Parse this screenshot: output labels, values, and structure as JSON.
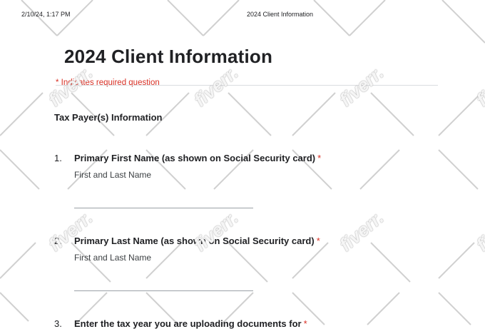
{
  "print_header": {
    "datetime": "2/10/24, 1:17 PM",
    "doc_title": "2024 Client Information"
  },
  "form": {
    "title": "2024 Client Information",
    "required_note": "* Indicates required question",
    "section_title": "Tax Payer(s) Information",
    "questions": [
      {
        "number": "1.",
        "label": "Primary First Name (as shown on Social Security card)",
        "required_marker": "*",
        "help": "First and Last Name"
      },
      {
        "number": "2.",
        "label": "Primary Last Name (as shown on Social Security card)",
        "required_marker": "*",
        "help": "First and Last Name"
      },
      {
        "number": "3.",
        "label": "Enter the tax year you are uploading documents for",
        "required_marker": "*"
      }
    ]
  },
  "watermark": {
    "text": "fiverr."
  },
  "colors": {
    "required": "#d93025",
    "text": "#202124",
    "rule": "#dadce0"
  }
}
